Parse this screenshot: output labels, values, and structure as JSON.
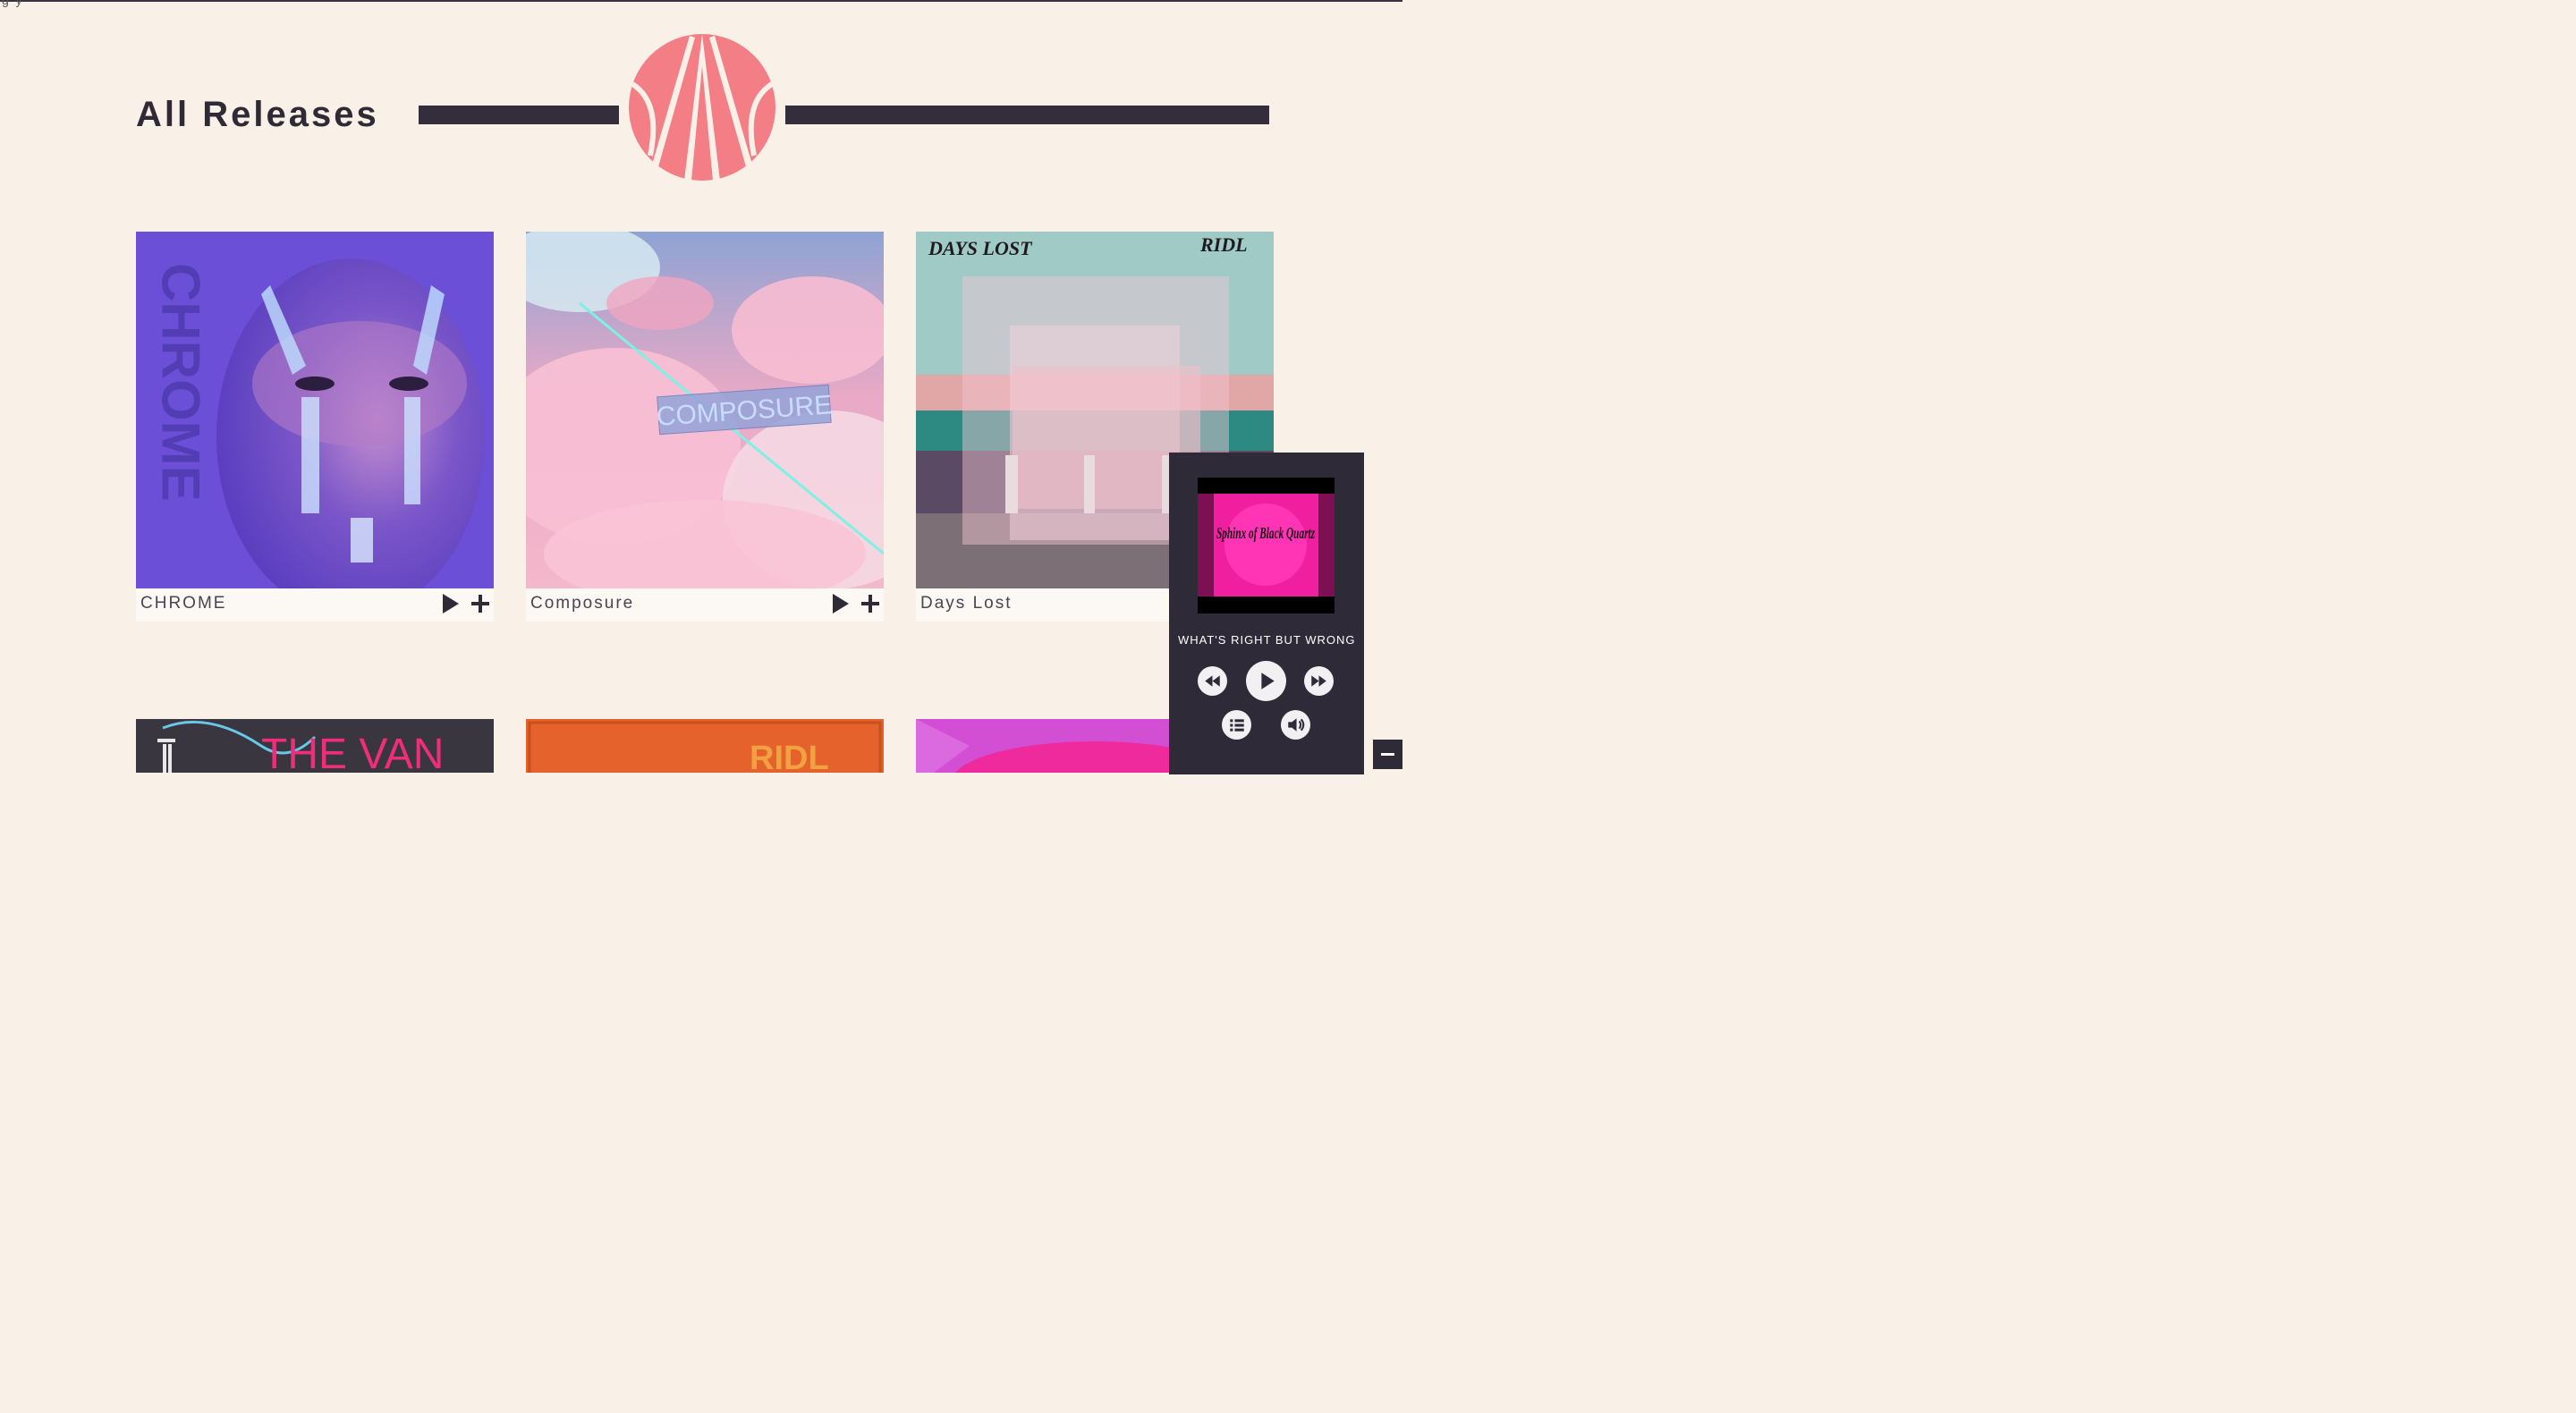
{
  "page": {
    "title": "All Releases",
    "top_fragment": "g  y"
  },
  "colors": {
    "background": "#f9f1e8",
    "accent": "#f47e86",
    "dark": "#342e3c",
    "player_bg": "#2f2a38"
  },
  "releases": [
    {
      "title": "CHROME",
      "art_text": "CHROME"
    },
    {
      "title": "Composure",
      "art_text": "COMPOSURE"
    },
    {
      "title": "Days Lost",
      "art_text_left": "DAYS LOST",
      "art_text_right": "RIDL"
    }
  ],
  "releases_row2": [
    {
      "art_text": "THE VAN"
    },
    {
      "art_text": "RIDL"
    },
    {
      "art_text": ""
    }
  ],
  "player": {
    "track_title": "WHAT'S RIGHT BUT WRONG",
    "cover_text": "Sphinx of Black Quartz",
    "controls": [
      "rewind-icon",
      "play-icon",
      "fast-forward-icon",
      "playlist-icon",
      "volume-icon"
    ]
  },
  "icons": {
    "play": "play-icon",
    "add": "plus-icon",
    "minimize": "minus-icon"
  }
}
